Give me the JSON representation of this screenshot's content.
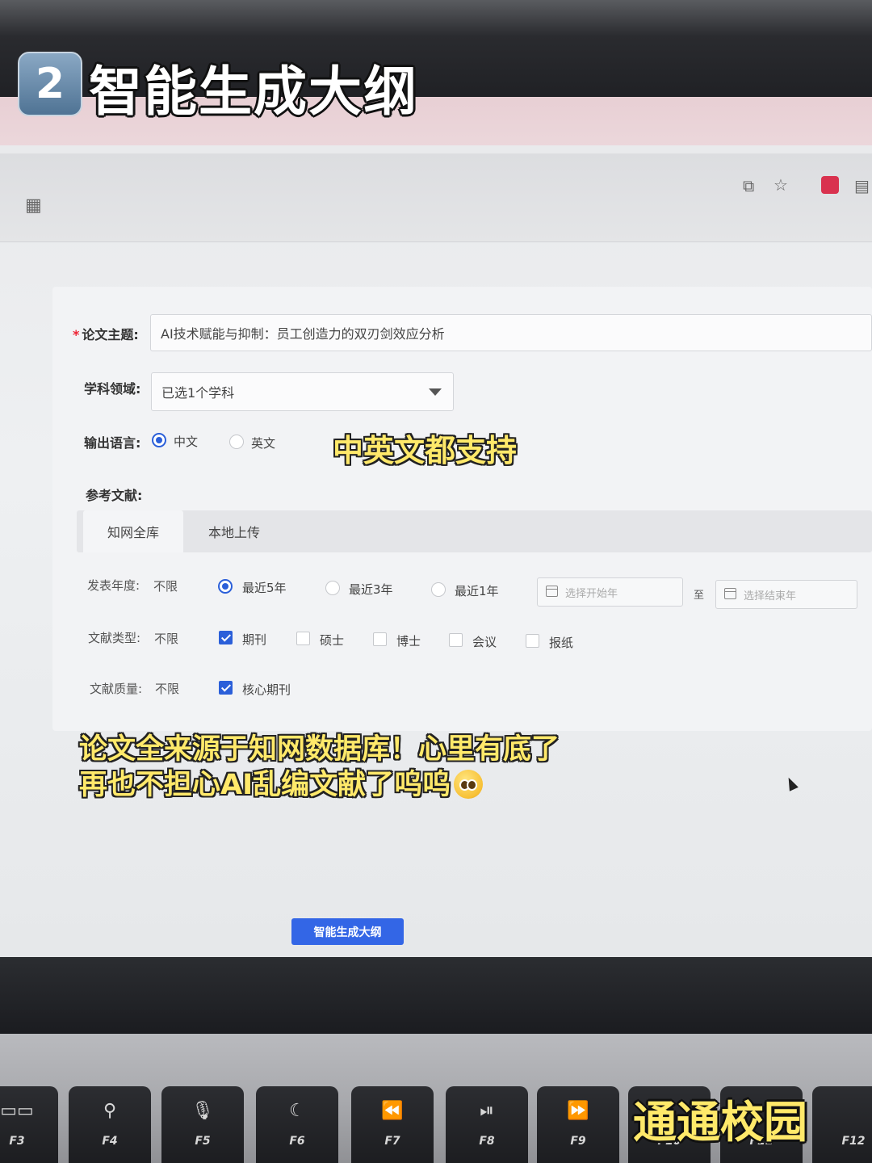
{
  "overlay": {
    "step_number": "2",
    "title": "智能生成大纲",
    "caption_language": "中英文都支持",
    "caption_source_line1": "论文全来源于知网数据库！心里有底了",
    "caption_source_line2": "再也不担心AI乱编文献了呜呜",
    "watermark": "通通校园"
  },
  "form": {
    "topic_label": "论文主题:",
    "topic_value": "AI技术赋能与抑制：员工创造力的双刃剑效应分析",
    "field_label": "学科领域:",
    "field_value": "已选1个学科",
    "language_label": "输出语言:",
    "language_options": [
      "中文",
      "英文"
    ],
    "language_selected": "中文",
    "references_label": "参考文献:",
    "tabs": [
      "知网全库",
      "本地上传"
    ],
    "active_tab": "知网全库",
    "year_label": "发表年度:",
    "year_unlimited": "不限",
    "year_options": [
      "最近5年",
      "最近3年",
      "最近1年"
    ],
    "year_selected": "最近5年",
    "start_year_placeholder": "选择开始年",
    "to_label": "至",
    "end_year_placeholder": "选择结束年",
    "type_label": "文献类型:",
    "type_unlimited": "不限",
    "type_options": [
      "期刊",
      "硕士",
      "博士",
      "会议",
      "报纸"
    ],
    "type_checked": [
      "期刊"
    ],
    "quality_label": "文献质量:",
    "quality_unlimited": "不限",
    "quality_options": [
      "核心期刊"
    ],
    "quality_checked": [
      "核心期刊"
    ],
    "generate_button": "智能生成大纲"
  },
  "keyboard": {
    "keys": [
      {
        "glyph": "▭▭",
        "fn": "F3"
      },
      {
        "glyph": "⚲",
        "fn": "F4"
      },
      {
        "glyph": "🎙",
        "fn": "F5"
      },
      {
        "glyph": "☾",
        "fn": "F6"
      },
      {
        "glyph": "⏪",
        "fn": "F7"
      },
      {
        "glyph": "⏯",
        "fn": "F8"
      },
      {
        "glyph": "⏩",
        "fn": "F9"
      },
      {
        "glyph": "",
        "fn": "F10"
      },
      {
        "glyph": "",
        "fn": "F11"
      },
      {
        "glyph": "",
        "fn": "F12"
      }
    ]
  },
  "colors": {
    "accent": "#2b5fd9",
    "button": "#3366e6",
    "caption_yellow": "#ffe96a"
  },
  "icons": [
    "translate-icon",
    "star-icon",
    "extension-icon",
    "apps-grid-icon",
    "calendar-icon",
    "dropdown-caret-icon"
  ]
}
